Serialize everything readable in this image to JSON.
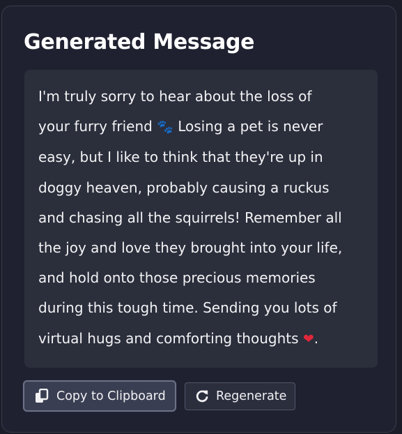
{
  "card": {
    "title": "Generated Message"
  },
  "message": {
    "line1": "I'm truly sorry to hear about the loss of",
    "line2_before_emoji": "your furry friend ",
    "paw_emoji": "🐾",
    "line2_after_emoji": " Losing a pet is never",
    "line3": "easy, but I like to think that they're up in",
    "line4": "doggy heaven, probably causing a ruckus",
    "line5": "and chasing all the squirrels! Remember all",
    "line6": "the joy and love they brought into your life,",
    "line7": "and hold onto those precious memories",
    "line8": "during this tough time. Sending you lots of",
    "line9_before_emoji": "virtual hugs and comforting thoughts ",
    "heart_emoji": "❤",
    "line9_after_emoji": "."
  },
  "actions": {
    "copy_label": "Copy to Clipboard",
    "copy_icon": "copy-icon",
    "regenerate_label": "Regenerate",
    "regenerate_icon": "refresh-icon"
  },
  "colors": {
    "background": "#1b1d29",
    "card": "#1f2130",
    "message_box": "#2b2e3b",
    "text": "#f3f3f5",
    "heart": "#e0283a"
  }
}
